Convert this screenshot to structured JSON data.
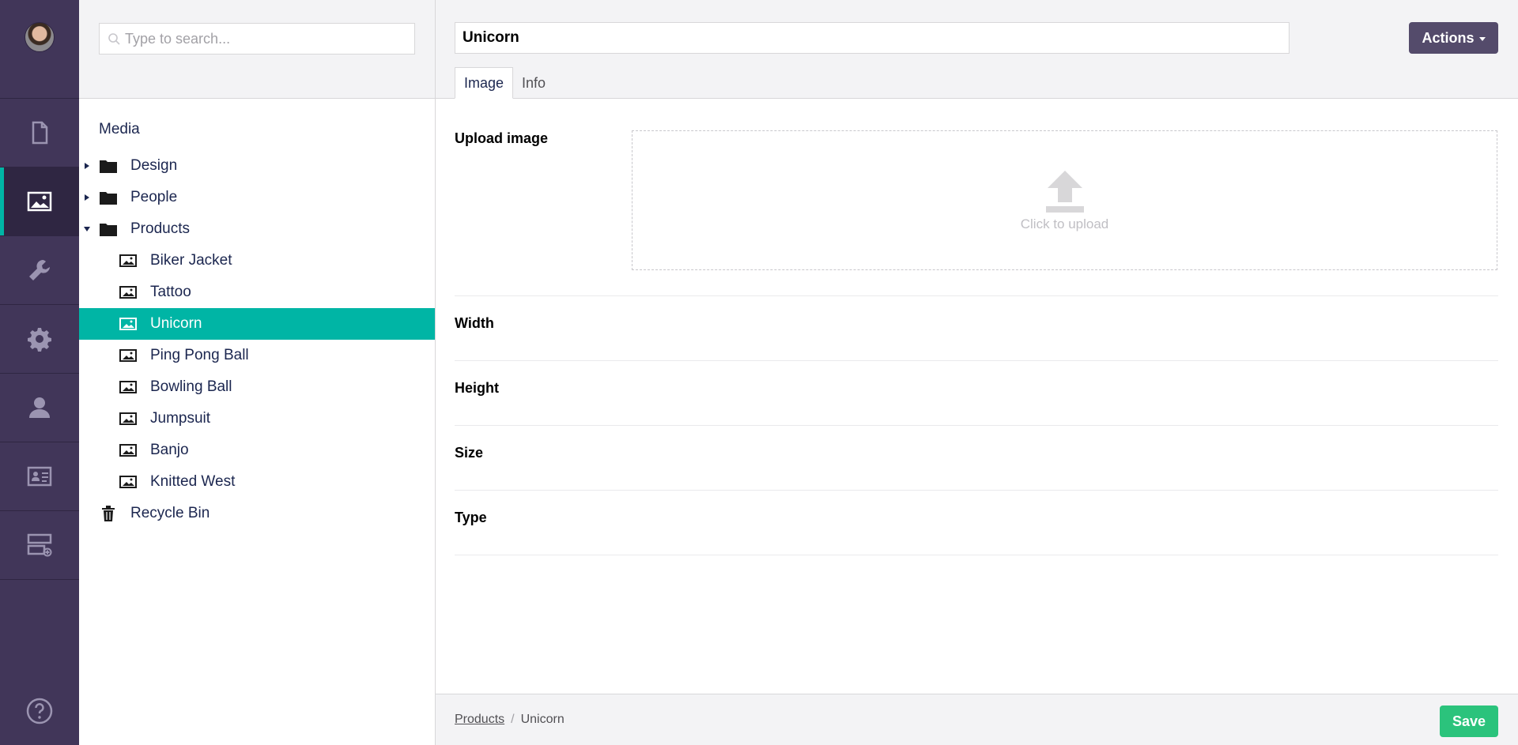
{
  "rail": {
    "items": [
      {
        "icon": "content-icon",
        "active": false
      },
      {
        "icon": "media-icon",
        "active": true
      },
      {
        "icon": "settings-wrench-icon",
        "active": false
      },
      {
        "icon": "developer-gear-icon",
        "active": false
      },
      {
        "icon": "users-icon",
        "active": false
      },
      {
        "icon": "members-icon",
        "active": false
      },
      {
        "icon": "forms-icon",
        "active": false
      }
    ],
    "help_icon": "help-icon"
  },
  "tree": {
    "search_placeholder": "Type to search...",
    "root_label": "Media",
    "folders": [
      {
        "label": "Design",
        "expanded": false
      },
      {
        "label": "People",
        "expanded": false
      },
      {
        "label": "Products",
        "expanded": true
      }
    ],
    "products_items": [
      {
        "label": "Biker Jacket"
      },
      {
        "label": "Tattoo"
      },
      {
        "label": "Unicorn",
        "selected": true
      },
      {
        "label": "Ping Pong Ball"
      },
      {
        "label": "Bowling Ball"
      },
      {
        "label": "Jumpsuit"
      },
      {
        "label": "Banjo"
      },
      {
        "label": "Knitted West"
      }
    ],
    "recycle_bin_label": "Recycle Bin"
  },
  "editor": {
    "name_value": "Unicorn",
    "actions_label": "Actions",
    "tabs": [
      {
        "label": "Image",
        "active": true
      },
      {
        "label": "Info",
        "active": false
      }
    ],
    "upload_label": "Upload image",
    "upload_text": "Click to upload",
    "properties": [
      {
        "label": "Width"
      },
      {
        "label": "Height"
      },
      {
        "label": "Size"
      },
      {
        "label": "Type"
      }
    ]
  },
  "footer": {
    "breadcrumb": [
      {
        "label": "Products",
        "link": true
      },
      {
        "label": "Unicorn",
        "link": false
      }
    ],
    "breadcrumb_separator": "/",
    "save_label": "Save"
  },
  "colors": {
    "rail_bg": "#413659",
    "accent": "#00b5a5",
    "actions_bg": "#544b6b",
    "save_bg": "#2bc37c"
  }
}
